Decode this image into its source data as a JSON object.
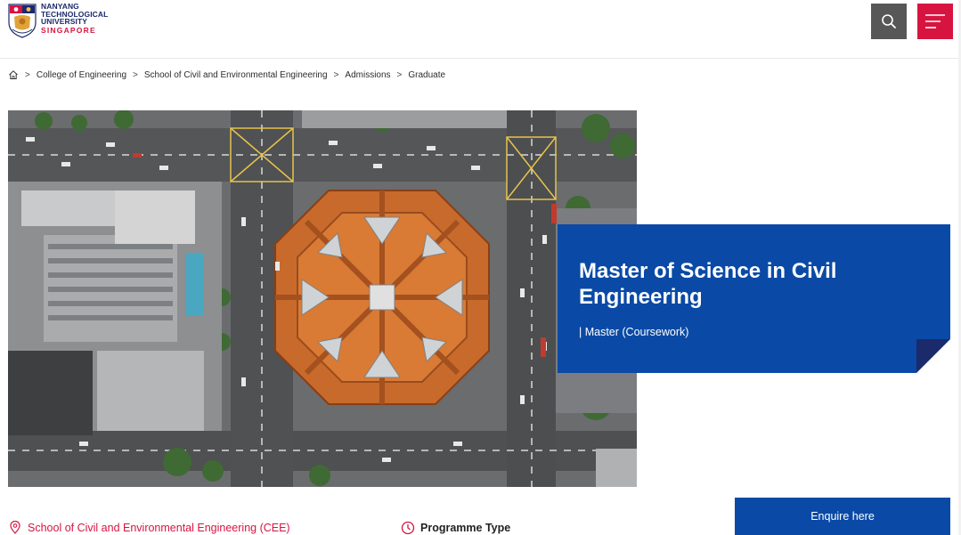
{
  "header": {
    "logo": {
      "lines": [
        "NANYANG",
        "TECHNOLOGICAL",
        "UNIVERSITY",
        "SINGAPORE"
      ]
    },
    "search_icon": "search-icon",
    "menu_icon": "hamburger-menu-icon",
    "colors": {
      "search_bg": "#575757",
      "menu_bg": "#d71440"
    }
  },
  "breadcrumb": {
    "home_icon": "home-icon",
    "separator": ">",
    "items": [
      "College of Engineering",
      "School of Civil and Environmental Engineering",
      "Admissions",
      "Graduate"
    ]
  },
  "hero": {
    "image": "aerial-view-octagonal-roof-building"
  },
  "programme": {
    "title": "Master of Science in Civil Engineering",
    "type": "| Master (Coursework)"
  },
  "bottom": {
    "school_link": "School of Civil and Environmental Engineering (CEE)",
    "programme_type_label": "Programme Type",
    "enquire_label": "Enquire here"
  },
  "colors": {
    "brand_blue": "#0a4aa6",
    "brand_red": "#d71440",
    "navy": "#1b2a6b"
  }
}
